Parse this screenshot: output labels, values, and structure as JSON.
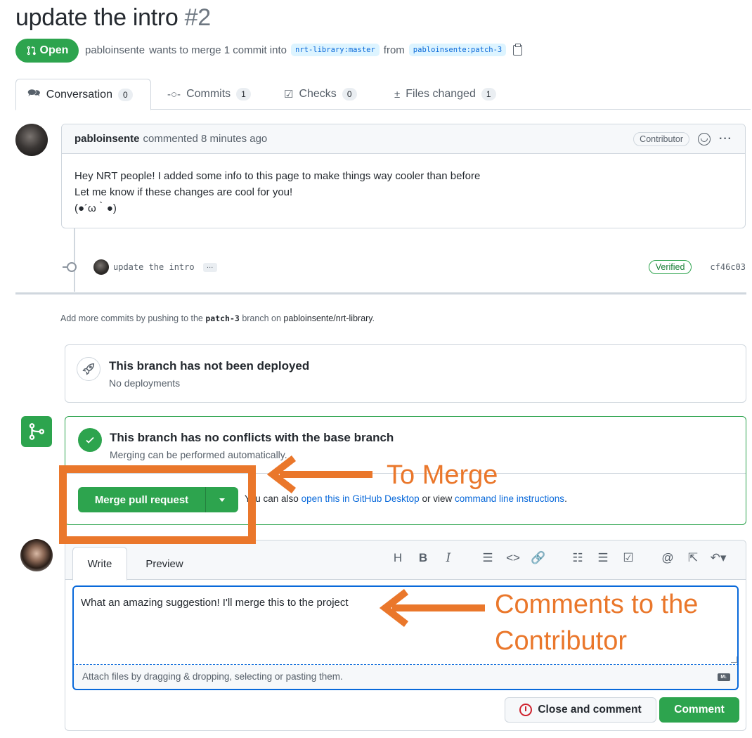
{
  "pr": {
    "title": "update the intro",
    "number": "#2",
    "status": "Open",
    "author": "pabloinsente",
    "merge_text": "wants to merge 1 commit into",
    "base_branch": "nrt-library:master",
    "from_text": "from",
    "head_branch": "pabloinsente:patch-3"
  },
  "tabs": [
    {
      "label": "Conversation",
      "count": "0",
      "icon": "comment-icon"
    },
    {
      "label": "Commits",
      "count": "1",
      "icon": "commit-icon"
    },
    {
      "label": "Checks",
      "count": "0",
      "icon": "checklist-icon"
    },
    {
      "label": "Files changed",
      "count": "1",
      "icon": "diff-icon"
    }
  ],
  "comment": {
    "author": "pabloinsente",
    "meta": "commented 8 minutes ago",
    "badge": "Contributor",
    "lines": [
      "Hey NRT people! I added some info to this page to make things way cooler than before",
      "Let me know if these changes are cool for you!",
      "(●´ω｀●)"
    ]
  },
  "commit": {
    "message": "update the intro",
    "more": "…",
    "verified": "Verified",
    "sha": "cf46c03"
  },
  "hint": {
    "prefix": "Add more commits by pushing to the",
    "branch": "patch-3",
    "middle": "branch on",
    "repo": "pabloinsente/nrt-library",
    "suffix": "."
  },
  "deploy": {
    "title": "This branch has not been deployed",
    "subtitle": "No deployments"
  },
  "merge": {
    "title": "This branch has no conflicts with the base branch",
    "subtitle": "Merging can be performed automatically.",
    "button": "Merge pull request",
    "also_prefix": "You can also",
    "desktop_link": "open this in GitHub Desktop",
    "or_view": "or view",
    "cli_link": "command line instructions",
    "also_suffix": "."
  },
  "editor": {
    "tab_write": "Write",
    "tab_preview": "Preview",
    "toolbar": [
      "H",
      "B",
      "I"
    ],
    "text": "What an amazing suggestion! I'll merge this to the project",
    "attach": "Attach files by dragging & dropping, selecting or pasting them.",
    "md_badge": "M↓",
    "close_button": "Close and comment",
    "comment_button": "Comment"
  },
  "annotations": {
    "merge": "To Merge",
    "comments_line1": "Comments to the",
    "comments_line2": "Contributor"
  },
  "colors": {
    "accent_green": "#2da44e",
    "link_blue": "#0969da",
    "annotation_orange": "#ea772b"
  }
}
